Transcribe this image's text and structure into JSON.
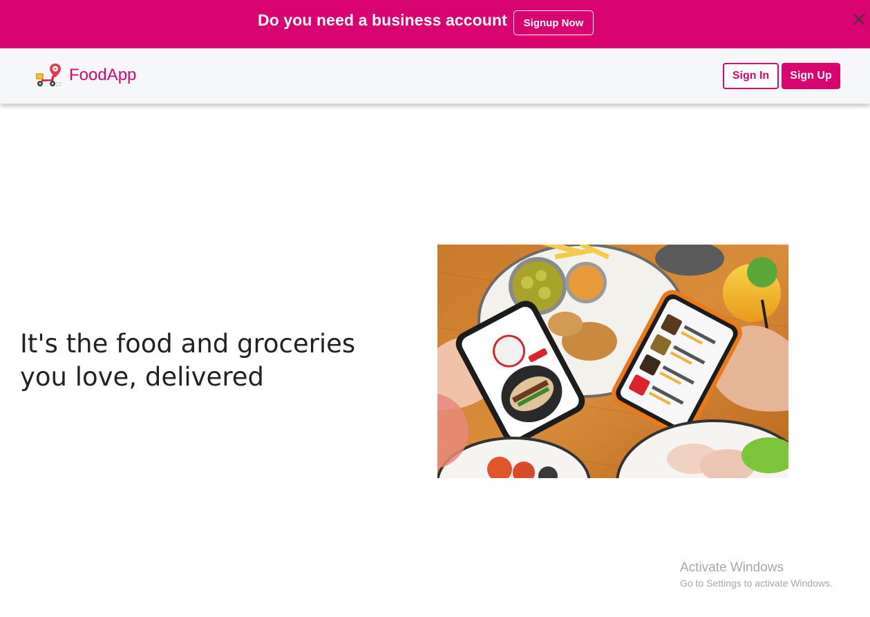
{
  "banner": {
    "text": "Do you need a business account",
    "button_label": "Signup Now",
    "close_icon": "close-icon",
    "background": "#d9046f"
  },
  "navbar": {
    "brand": "FoodApp",
    "logo_icon": "delivery-scooter-logo-icon",
    "signin_label": "Sign In",
    "signup_label": "Sign Up",
    "accent": "#d9046f"
  },
  "hero": {
    "heading_line1": "It's the food and groceries",
    "heading_line2": "you love, delivered",
    "image": "people-ordering-food-with-phones-photo"
  },
  "watermark": {
    "title": "Activate Windows",
    "subtitle": "Go to Settings to activate Windows."
  }
}
